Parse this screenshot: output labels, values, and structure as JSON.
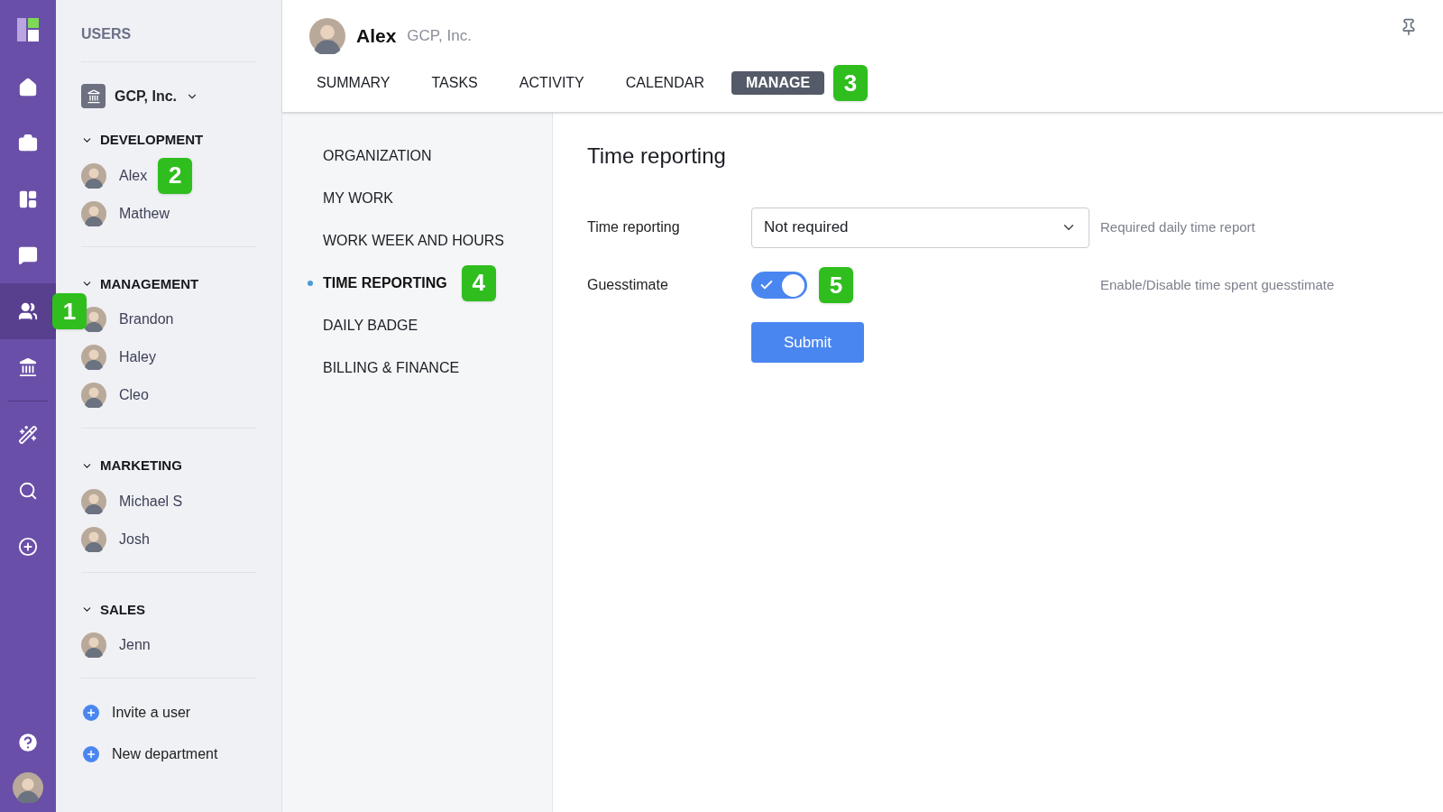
{
  "rail": {
    "items": [
      {
        "kind": "home",
        "selected": false
      },
      {
        "kind": "briefcase",
        "selected": false
      },
      {
        "kind": "board",
        "selected": false
      },
      {
        "kind": "chat",
        "selected": false
      },
      {
        "kind": "users",
        "selected": true,
        "callout": "1"
      },
      {
        "kind": "bank",
        "selected": false
      },
      {
        "kind": "wand",
        "selected": false
      },
      {
        "kind": "search",
        "selected": false
      },
      {
        "kind": "add",
        "selected": false
      }
    ]
  },
  "users_panel": {
    "title": "USERS",
    "organization": "GCP, Inc.",
    "departments": [
      {
        "name": "DEVELOPMENT",
        "expanded": true,
        "members": [
          {
            "name": "Alex",
            "callout": "2"
          },
          {
            "name": "Mathew"
          }
        ]
      },
      {
        "name": "MANAGEMENT",
        "expanded": true,
        "members": [
          {
            "name": "Brandon"
          },
          {
            "name": "Haley"
          },
          {
            "name": "Cleo"
          }
        ]
      },
      {
        "name": "MARKETING",
        "expanded": true,
        "members": [
          {
            "name": "Michael S"
          },
          {
            "name": "Josh"
          }
        ]
      },
      {
        "name": "SALES",
        "expanded": true,
        "members": [
          {
            "name": "Jenn"
          }
        ]
      }
    ],
    "actions": [
      "Invite a user",
      "New department"
    ]
  },
  "header": {
    "user": "Alex",
    "company": "GCP, Inc.",
    "tabs": [
      {
        "label": "SUMMARY",
        "selected": false
      },
      {
        "label": "TASKS",
        "selected": false
      },
      {
        "label": "ACTIVITY",
        "selected": false
      },
      {
        "label": "CALENDAR",
        "selected": false
      },
      {
        "label": "MANAGE",
        "selected": true,
        "callout": "3"
      }
    ]
  },
  "manage_menu": [
    {
      "label": "ORGANIZATION",
      "selected": false
    },
    {
      "label": "MY WORK",
      "selected": false
    },
    {
      "label": "WORK WEEK AND HOURS",
      "selected": false
    },
    {
      "label": "TIME REPORTING",
      "selected": true,
      "callout": "4"
    },
    {
      "label": "DAILY BADGE",
      "selected": false
    },
    {
      "label": "BILLING & FINANCE",
      "selected": false
    }
  ],
  "form": {
    "title": "Time reporting",
    "fields": [
      {
        "kind": "select",
        "label": "Time reporting",
        "value": "Not required",
        "hint": "Required daily time report"
      },
      {
        "kind": "toggle",
        "label": "Guesstimate",
        "on": true,
        "hint": "Enable/Disable time spent guesstimate",
        "callout": "5"
      }
    ],
    "submit": "Submit"
  }
}
